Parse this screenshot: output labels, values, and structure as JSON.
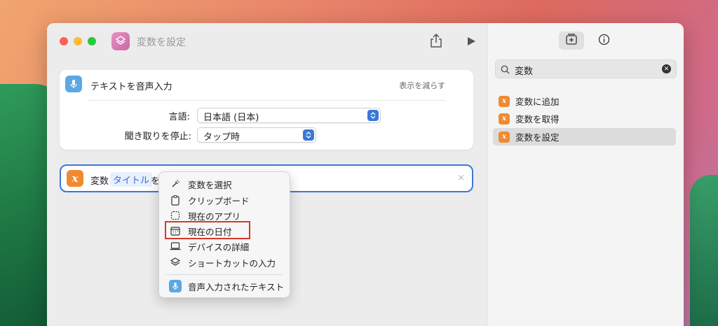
{
  "window": {
    "title": "変数を設定"
  },
  "card1": {
    "title": "テキストを音声入力",
    "show_less": "表示を減らす",
    "language_label": "言語:",
    "language_value": "日本語 (日本)",
    "stop_label": "聞き取りを停止:",
    "stop_value": "タップ時"
  },
  "card2": {
    "prefix": "変数",
    "token": "タイトル",
    "suffix": "を",
    "close": "×"
  },
  "menu": {
    "items": [
      {
        "label": "変数を選択",
        "icon": "magic-wand-icon"
      },
      {
        "label": "クリップボード",
        "icon": "clipboard-icon"
      },
      {
        "label": "現在のアプリ",
        "icon": "app-frame-icon"
      },
      {
        "label": "現在の日付",
        "icon": "calendar-icon"
      },
      {
        "label": "デバイスの詳細",
        "icon": "laptop-icon"
      },
      {
        "label": "ショートカットの入力",
        "icon": "shortcuts-icon"
      },
      {
        "label": "音声入力されたテキスト",
        "icon": "microphone-icon"
      }
    ],
    "highlight_color": "#d33a2c"
  },
  "sidebar": {
    "search_value": "変数",
    "results": [
      {
        "label": "変数に追加"
      },
      {
        "label": "変数を取得"
      },
      {
        "label": "変数を設定"
      }
    ]
  },
  "colors": {
    "accent": "#3b78d8",
    "variable_badge": "#f08a30",
    "speech_badge": "#5aa8e6"
  }
}
